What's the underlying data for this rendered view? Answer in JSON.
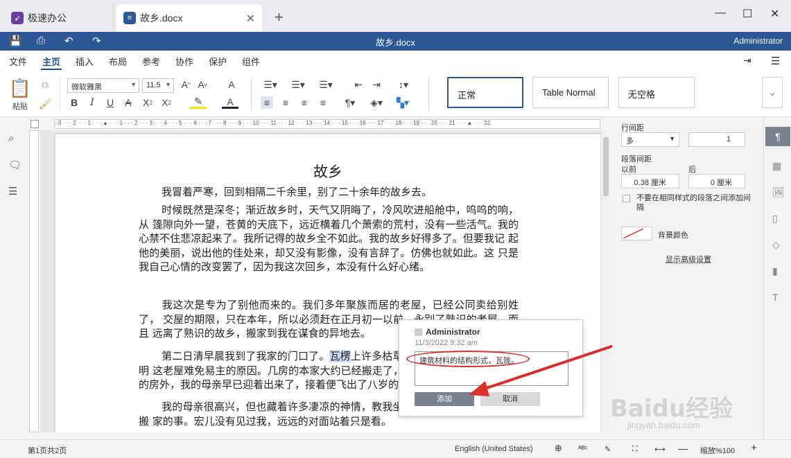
{
  "tabs": [
    {
      "label": "极速办公",
      "icon": "rocket-icon",
      "color": "#6b3fa0"
    },
    {
      "label": "故乡.docx",
      "icon": "document-icon",
      "color": "#2c5696"
    }
  ],
  "title_bar": {
    "title": "故乡.docx",
    "user": "Administrator"
  },
  "menu": [
    "文件",
    "主页",
    "插入",
    "布局",
    "参考",
    "协作",
    "保护",
    "组件"
  ],
  "ribbon": {
    "paste_label": "粘贴",
    "font_name": "微软雅黑",
    "font_size": "11.5",
    "styles": [
      "正常",
      "Table Normal",
      "无空格"
    ]
  },
  "document": {
    "title": "故乡",
    "paragraphs": [
      "我冒着严寒，回到相隔二千余里，别了二十余年的故乡去。",
      "时候既然是深冬；渐近故乡时，天气又阴晦了，冷风吹进船舱中，呜呜的响，从 篷隙向外一望，苍黄的天底下，远近横着几个萧索的荒村，没有一些活气。我的 心禁不住悲凉起来了。我所记得的故乡全不如此。我的故乡好得多了。但要我记 起他的美丽，说出他的佳处来，却又没有影像，没有言辞了。仿佛也就如此。这 只是我自己心情的改变罢了，因为我这次回乡，本没有什么好心绪。",
      "我这次是专为了别他而来的。我们多年聚族而居的老屋，已经公同卖给别姓了， 交屋的期限，只在本年，所以必须赶在正月初一以前，永别了熟识的老屋，而且 远离了熟识的故乡，搬家到我在谋食的异地去。",
      "第二日清早晨我到了我家的门口了。",
      "瓦楞",
      "上许多枯草的断茎当风抖着，正在说明 这老屋难免易主的原因。几房的本家大约已经搬走了，所以很寂静。我到了自家 的房外，我的母亲早已迎着出来了，接着便飞出了八岁的侄儿宏儿。",
      "我的母亲很高兴，但也藏着许多凄凉的神情，教我坐下，歇息，喝茶，且不谈搬 家的事。宏儿没有见过我，远远的对面站着只是看。"
    ]
  },
  "comment": {
    "author": "Administrator",
    "date": "11/3/2022 9:32 am",
    "text": "建筑材料的结构形式，瓦陇。",
    "add_label": "添加",
    "cancel_label": "取消"
  },
  "right_panel": {
    "line_spacing_label": "行间距",
    "line_spacing_mode": "多",
    "line_spacing_value": "1",
    "para_spacing_label": "段落间距",
    "before_label": "以前",
    "after_label": "后",
    "before_value": "0.38 厘米",
    "after_value": "0 厘米",
    "no_space_label": "不要在相同样式的段落之间添加间隔",
    "bg_color_label": "背景颜色",
    "advanced_label": "显示高级设置"
  },
  "status": {
    "page_info": "第1页共2页",
    "language": "English (United States)",
    "zoom": "缩放%100"
  },
  "watermark": {
    "text": "Baidu经验",
    "url_text": "jingyan.baidu.com"
  }
}
